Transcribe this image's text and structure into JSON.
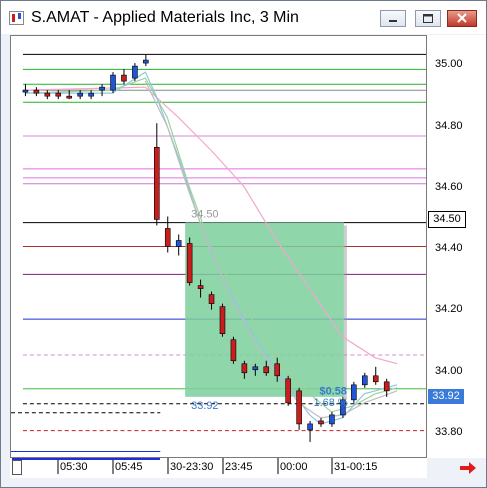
{
  "window": {
    "title": "S.AMAT - Applied Materials Inc, 3 Min",
    "buttons": [
      "minimize",
      "maximize",
      "close"
    ]
  },
  "axis": {
    "y_labels": [
      "35.00",
      "34.80",
      "34.60",
      "34.40",
      "34.20",
      "34.00",
      "33.80"
    ],
    "y_tag_black": "34.50",
    "y_tag_blue": "33.92",
    "x_labels": [
      "05:30",
      "05:45",
      "30-23:30",
      "23:45",
      "00:00",
      "31-00:15"
    ]
  },
  "annotations": {
    "top_level": "34.50",
    "bottom_level": "33.92",
    "change_value": "$0.58",
    "change_pct": "1.68 %"
  },
  "colors": {
    "bull_candle": "#1f55d6",
    "bear_candle": "#c81e1e",
    "measure_box": "#7dcf9c",
    "label_blue": "#3a7bc8"
  },
  "chart_data": {
    "type": "candlestick",
    "title": "S.AMAT - Applied Materials Inc, 3 Min",
    "ylim": [
      33.72,
      35.12
    ],
    "x_labels": [
      "05:30",
      "05:45",
      "30-23:30",
      "23:45",
      "00:00",
      "31-00:15"
    ],
    "candles": [
      {
        "o": 34.94,
        "h": 34.96,
        "l": 34.92,
        "c": 34.94,
        "dir": "bull"
      },
      {
        "o": 34.94,
        "h": 34.95,
        "l": 34.92,
        "c": 34.93,
        "dir": "bear"
      },
      {
        "o": 34.93,
        "h": 34.94,
        "l": 34.91,
        "c": 34.92,
        "dir": "bear"
      },
      {
        "o": 34.93,
        "h": 34.94,
        "l": 34.91,
        "c": 34.92,
        "dir": "bear"
      },
      {
        "o": 34.92,
        "h": 34.94,
        "l": 34.91,
        "c": 34.92,
        "dir": "bear"
      },
      {
        "o": 34.92,
        "h": 34.94,
        "l": 34.91,
        "c": 34.93,
        "dir": "bull"
      },
      {
        "o": 34.92,
        "h": 34.94,
        "l": 34.91,
        "c": 34.93,
        "dir": "bull"
      },
      {
        "o": 34.94,
        "h": 34.96,
        "l": 34.92,
        "c": 34.95,
        "dir": "bull"
      },
      {
        "o": 34.94,
        "h": 35.0,
        "l": 34.93,
        "c": 34.99,
        "dir": "bull"
      },
      {
        "o": 34.97,
        "h": 35.01,
        "l": 34.96,
        "c": 34.99,
        "dir": "bear"
      },
      {
        "o": 34.98,
        "h": 35.03,
        "l": 34.97,
        "c": 35.02,
        "dir": "bull"
      },
      {
        "o": 35.03,
        "h": 35.06,
        "l": 35.02,
        "c": 35.04,
        "dir": "bull"
      },
      {
        "o": 34.75,
        "h": 34.83,
        "l": 34.49,
        "c": 34.51,
        "dir": "bear"
      },
      {
        "o": 34.48,
        "h": 34.52,
        "l": 34.4,
        "c": 34.42,
        "dir": "bear"
      },
      {
        "o": 34.42,
        "h": 34.46,
        "l": 34.39,
        "c": 34.44,
        "dir": "bull"
      },
      {
        "o": 34.43,
        "h": 34.45,
        "l": 34.29,
        "c": 34.3,
        "dir": "bear"
      },
      {
        "o": 34.29,
        "h": 34.31,
        "l": 34.25,
        "c": 34.28,
        "dir": "bear"
      },
      {
        "o": 34.26,
        "h": 34.27,
        "l": 34.21,
        "c": 34.23,
        "dir": "bear"
      },
      {
        "o": 34.22,
        "h": 34.23,
        "l": 34.12,
        "c": 34.13,
        "dir": "bear"
      },
      {
        "o": 34.11,
        "h": 34.12,
        "l": 34.03,
        "c": 34.04,
        "dir": "bear"
      },
      {
        "o": 34.03,
        "h": 34.04,
        "l": 33.98,
        "c": 34.0,
        "dir": "bear"
      },
      {
        "o": 34.01,
        "h": 34.03,
        "l": 33.99,
        "c": 34.02,
        "dir": "bull"
      },
      {
        "o": 34.02,
        "h": 34.04,
        "l": 33.99,
        "c": 34.0,
        "dir": "bear"
      },
      {
        "o": 34.03,
        "h": 34.05,
        "l": 33.97,
        "c": 33.99,
        "dir": "bear"
      },
      {
        "o": 33.98,
        "h": 33.99,
        "l": 33.89,
        "c": 33.9,
        "dir": "bear"
      },
      {
        "o": 33.94,
        "h": 33.95,
        "l": 33.81,
        "c": 33.83,
        "dir": "bear"
      },
      {
        "o": 33.81,
        "h": 33.84,
        "l": 33.77,
        "c": 33.83,
        "dir": "bull"
      },
      {
        "o": 33.83,
        "h": 33.85,
        "l": 33.82,
        "c": 33.84,
        "dir": "bear"
      },
      {
        "o": 33.83,
        "h": 33.87,
        "l": 33.82,
        "c": 33.86,
        "dir": "bull"
      },
      {
        "o": 33.86,
        "h": 33.92,
        "l": 33.85,
        "c": 33.91,
        "dir": "bull"
      },
      {
        "o": 33.91,
        "h": 33.97,
        "l": 33.9,
        "c": 33.96,
        "dir": "bull"
      },
      {
        "o": 33.96,
        "h": 34.0,
        "l": 33.95,
        "c": 33.99,
        "dir": "bull"
      },
      {
        "o": 33.99,
        "h": 34.02,
        "l": 33.96,
        "c": 33.97,
        "dir": "bear"
      },
      {
        "o": 33.97,
        "h": 33.98,
        "l": 33.92,
        "c": 33.94,
        "dir": "bear"
      }
    ],
    "hlines": [
      {
        "y": 35.06,
        "color": "#000000",
        "style": "solid",
        "scope": "full"
      },
      {
        "y": 35.01,
        "color": "#22b322",
        "style": "solid",
        "scope": "full"
      },
      {
        "y": 34.96,
        "color": "#22b322",
        "style": "solid",
        "scope": "full"
      },
      {
        "y": 34.94,
        "color": "#888888",
        "style": "solid",
        "scope": "full"
      },
      {
        "y": 34.9,
        "color": "#22b322",
        "style": "solid",
        "scope": "full"
      },
      {
        "y": 34.79,
        "color": "#d38cd3",
        "style": "solid",
        "scope": "full"
      },
      {
        "y": 34.68,
        "color": "#e86ee8",
        "style": "solid",
        "scope": "full"
      },
      {
        "y": 34.65,
        "color": "#e86ee8",
        "style": "solid",
        "scope": "full"
      },
      {
        "y": 34.63,
        "color": "#c77ac7",
        "style": "solid",
        "scope": "full"
      },
      {
        "y": 34.5,
        "color": "#000000",
        "style": "solid",
        "scope": "full"
      },
      {
        "y": 34.42,
        "color": "#b03030",
        "style": "solid",
        "scope": "full"
      },
      {
        "y": 34.33,
        "color": "#7a1f7a",
        "style": "solid",
        "scope": "full"
      },
      {
        "y": 34.18,
        "color": "#1f2fd0",
        "style": "solid",
        "scope": "full"
      },
      {
        "y": 34.06,
        "color": "#d38cd3",
        "style": "dashed",
        "scope": "full"
      },
      {
        "y": 33.95,
        "color": "#22b322",
        "style": "solid",
        "scope": "full"
      },
      {
        "y": 33.9,
        "color": "#000000",
        "style": "dashed",
        "scope": "full"
      },
      {
        "y": 33.81,
        "color": "#c81e1e",
        "style": "dashed",
        "scope": "full"
      },
      {
        "y": 33.87,
        "color": "#000000",
        "style": "dashed",
        "scope": "left"
      },
      {
        "y": 33.74,
        "color": "#1f2fd0",
        "style": "solid",
        "scope": "left"
      }
    ],
    "overlays": [
      {
        "name": "ma-pink",
        "color": "#f3a6c9",
        "points": [
          [
            0,
            34.94
          ],
          [
            11,
            34.95
          ],
          [
            14,
            34.85
          ],
          [
            17,
            34.74
          ],
          [
            20,
            34.62
          ],
          [
            23,
            34.44
          ],
          [
            26,
            34.28
          ],
          [
            29,
            34.12
          ],
          [
            32,
            34.05
          ],
          [
            34,
            34.03
          ]
        ]
      },
      {
        "name": "ma-green",
        "color": "#9bd39b",
        "points": [
          [
            0,
            34.93
          ],
          [
            8,
            34.94
          ],
          [
            11,
            34.98
          ],
          [
            13,
            34.85
          ],
          [
            15,
            34.62
          ],
          [
            17,
            34.42
          ],
          [
            20,
            34.22
          ],
          [
            23,
            34.05
          ],
          [
            26,
            33.93
          ],
          [
            28,
            33.87
          ],
          [
            30,
            33.89
          ],
          [
            32,
            33.93
          ],
          [
            34,
            33.95
          ]
        ]
      },
      {
        "name": "ma-cyan",
        "color": "#8fc6e0",
        "points": [
          [
            0,
            34.93
          ],
          [
            8,
            34.93
          ],
          [
            11,
            35.0
          ],
          [
            12,
            34.92
          ],
          [
            14,
            34.72
          ],
          [
            16,
            34.5
          ],
          [
            18,
            34.32
          ],
          [
            20,
            34.18
          ],
          [
            22,
            34.06
          ],
          [
            24,
            33.96
          ],
          [
            26,
            33.86
          ],
          [
            27,
            33.83
          ],
          [
            29,
            33.85
          ],
          [
            31,
            33.93
          ],
          [
            34,
            33.96
          ]
        ]
      },
      {
        "name": "ma-gray",
        "color": "#bdbdbd",
        "points": [
          [
            11,
            34.97
          ],
          [
            13,
            34.82
          ],
          [
            15,
            34.6
          ],
          [
            17,
            34.4
          ],
          [
            19,
            34.24
          ],
          [
            21,
            34.1
          ],
          [
            23,
            34.0
          ],
          [
            25,
            33.9
          ],
          [
            27,
            33.85
          ],
          [
            29,
            33.86
          ],
          [
            31,
            33.9
          ],
          [
            34,
            33.94
          ]
        ]
      }
    ],
    "measure_box": {
      "x0": 15,
      "x1": 29.5,
      "y0": 34.5,
      "y1": 33.92
    }
  }
}
